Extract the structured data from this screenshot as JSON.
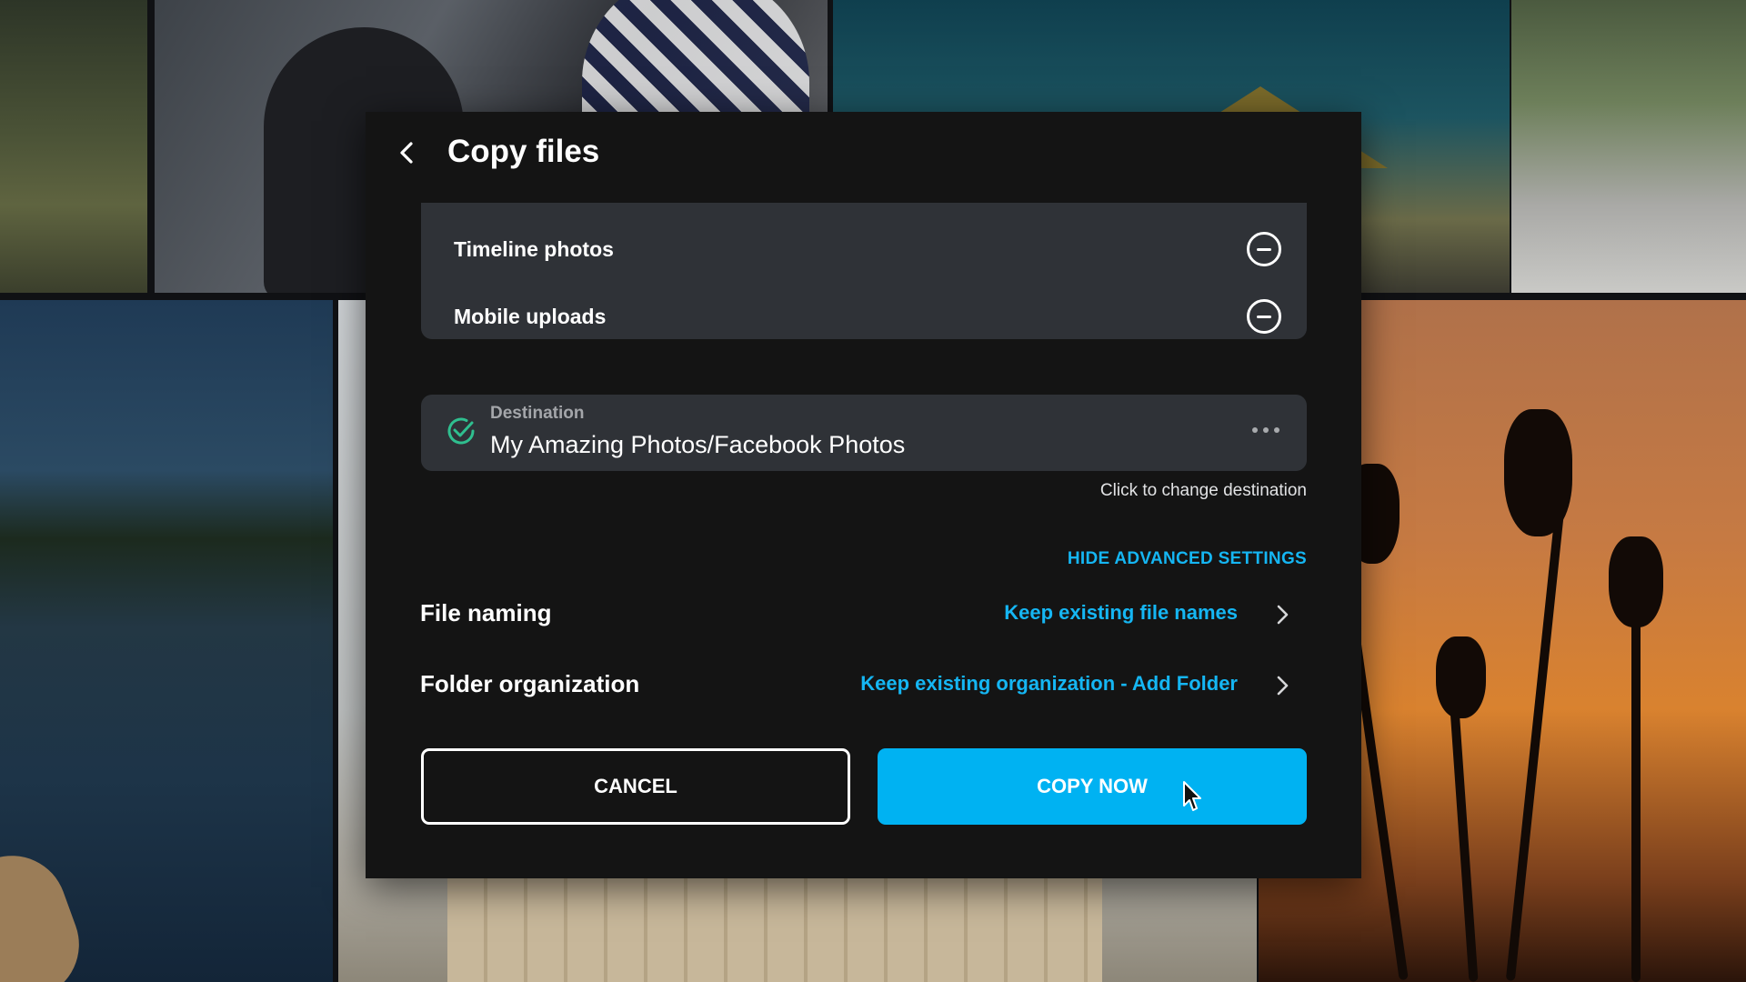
{
  "dialog": {
    "title": "Copy files",
    "back_icon": "chevron-left-icon",
    "sources": [
      {
        "label": "Timeline photos",
        "action_icon": "minus-circle-icon"
      },
      {
        "label": "Mobile uploads",
        "action_icon": "minus-circle-icon"
      }
    ],
    "destination": {
      "label": "Destination",
      "path": "My Amazing Photos/Facebook Photos",
      "status_icon": "check-circle-icon",
      "menu_icon": "more-horizontal-icon",
      "hint": "Click to change destination"
    },
    "advanced_link": "HIDE ADVANCED SETTINGS",
    "settings": [
      {
        "label": "File naming",
        "value": "Keep existing file names"
      },
      {
        "label": "Folder organization",
        "value": "Keep existing organization - Add Folder"
      }
    ],
    "buttons": {
      "cancel": "CANCEL",
      "copy": "COPY NOW"
    }
  },
  "colors": {
    "accent": "#00b2f2",
    "link": "#15b6f3",
    "success": "#2fbf8f",
    "dialog_bg": "#141414",
    "panel_bg": "#2f3237"
  }
}
